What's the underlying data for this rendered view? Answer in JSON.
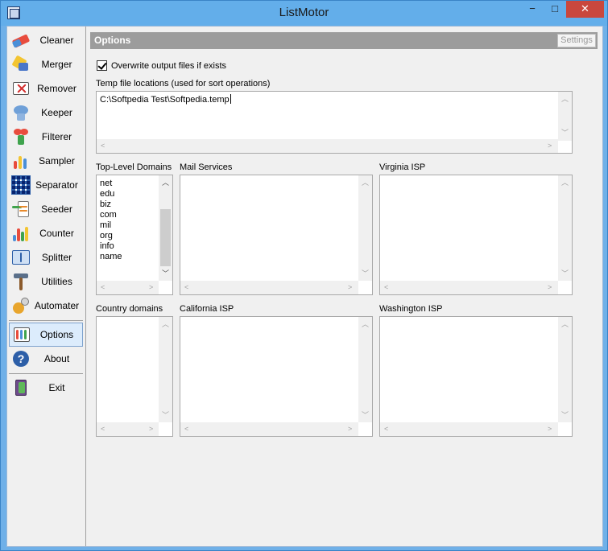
{
  "window": {
    "title": "ListMotor",
    "min": "−",
    "max": "□",
    "close": "✕"
  },
  "sidebar": {
    "items": [
      {
        "label": "Cleaner",
        "icon": "eraser-icon"
      },
      {
        "label": "Merger",
        "icon": "merge-icon"
      },
      {
        "label": "Remover",
        "icon": "remove-icon"
      },
      {
        "label": "Keeper",
        "icon": "keeper-icon"
      },
      {
        "label": "Filterer",
        "icon": "funnel-icon"
      },
      {
        "label": "Sampler",
        "icon": "sampler-icon"
      },
      {
        "label": "Separator",
        "icon": "grid-icon"
      },
      {
        "label": "Seeder",
        "icon": "seeder-icon"
      },
      {
        "label": "Counter",
        "icon": "bar-chart-icon"
      },
      {
        "label": "Splitter",
        "icon": "ruler-icon"
      },
      {
        "label": "Utilities",
        "icon": "hammer-icon"
      },
      {
        "label": "Automater",
        "icon": "gears-icon"
      },
      {
        "label": "Options",
        "icon": "options-icon",
        "active": true
      },
      {
        "label": "About",
        "icon": "help-icon"
      },
      {
        "label": "Exit",
        "icon": "door-icon"
      }
    ]
  },
  "main": {
    "header": "Options",
    "settings_button": "Settings",
    "overwrite_label": "Overwrite output files if exists",
    "overwrite_checked": true,
    "temp_label": "Temp file locations (used for sort operations)",
    "temp_value": "C:\\Softpedia Test\\Softpedia.temp",
    "lists": {
      "tld": {
        "label": "Top-Level Domains",
        "items": [
          "net",
          "edu",
          "biz",
          "com",
          "mil",
          "org",
          "info",
          "name"
        ]
      },
      "mail": {
        "label": "Mail Services"
      },
      "virginia": {
        "label": "Virginia ISP"
      },
      "country": {
        "label": "Country domains"
      },
      "california": {
        "label": "California ISP"
      },
      "washington": {
        "label": "Washington ISP"
      }
    }
  },
  "colors": {
    "titlebar": "#63aeea",
    "close": "#c9473d",
    "header": "#9c9c9c",
    "active_nav": "#dcecfc"
  }
}
